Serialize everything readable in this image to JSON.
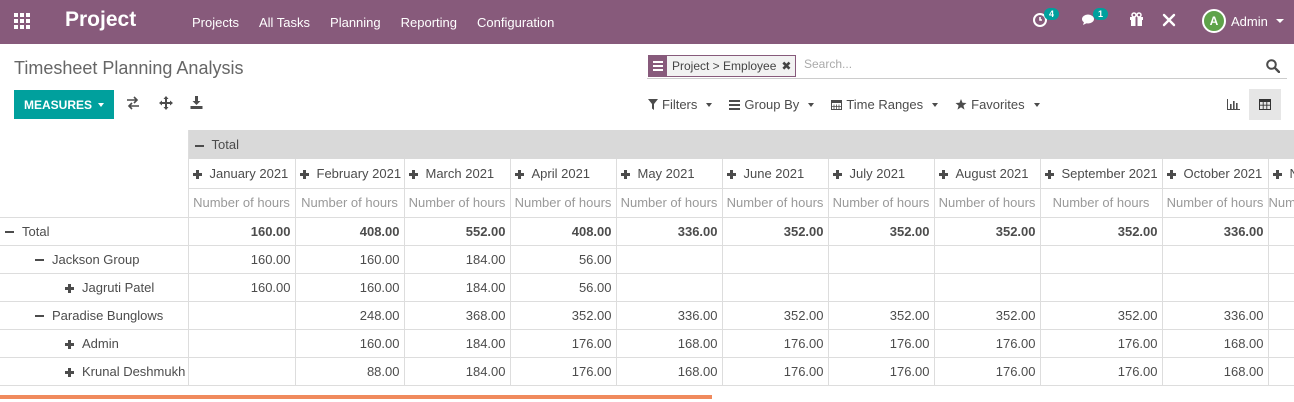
{
  "navbar": {
    "app_name": "Project",
    "menu": [
      "Projects",
      "All Tasks",
      "Planning",
      "Reporting",
      "Configuration"
    ],
    "activity_badge": "4",
    "messages_badge": "1",
    "avatar_initial": "A",
    "user_name": "Admin",
    "color": "#875a7b"
  },
  "control": {
    "title": "Timesheet Planning Analysis",
    "facet_label": "Project > Employee",
    "search_placeholder": "Search...",
    "measures_label": "MEASURES",
    "filters_label": "Filters",
    "group_by_label": "Group By",
    "time_ranges_label": "Time Ranges",
    "favorites_label": "Favorites",
    "accent": "#00a09d"
  },
  "pivot": {
    "total_header": "Total",
    "measure_label": "Number of hours",
    "columns": [
      "January 2021",
      "February 2021",
      "March 2021",
      "April 2021",
      "May 2021",
      "June 2021",
      "July 2021",
      "August 2021",
      "September 2021",
      "October 2021",
      "N"
    ],
    "rows": [
      {
        "label": "Total",
        "level": 0,
        "expanded": true,
        "bold": true,
        "values": [
          "160.00",
          "408.00",
          "552.00",
          "408.00",
          "336.00",
          "352.00",
          "352.00",
          "352.00",
          "352.00",
          "336.00",
          ""
        ]
      },
      {
        "label": "Jackson Group",
        "level": 1,
        "expanded": true,
        "bold": false,
        "values": [
          "160.00",
          "160.00",
          "184.00",
          "56.00",
          "",
          "",
          "",
          "",
          "",
          "",
          ""
        ]
      },
      {
        "label": "Jagruti Patel",
        "level": 2,
        "expanded": false,
        "bold": false,
        "values": [
          "160.00",
          "160.00",
          "184.00",
          "56.00",
          "",
          "",
          "",
          "",
          "",
          "",
          ""
        ]
      },
      {
        "label": "Paradise Bunglows",
        "level": 1,
        "expanded": true,
        "bold": false,
        "values": [
          "",
          "248.00",
          "368.00",
          "352.00",
          "336.00",
          "352.00",
          "352.00",
          "352.00",
          "352.00",
          "336.00",
          ""
        ]
      },
      {
        "label": "Admin",
        "level": 2,
        "expanded": false,
        "bold": false,
        "values": [
          "",
          "160.00",
          "184.00",
          "176.00",
          "168.00",
          "176.00",
          "176.00",
          "176.00",
          "176.00",
          "168.00",
          ""
        ]
      },
      {
        "label": "Krunal Deshmukh",
        "level": 2,
        "expanded": false,
        "bold": false,
        "values": [
          "",
          "88.00",
          "184.00",
          "176.00",
          "168.00",
          "176.00",
          "176.00",
          "176.00",
          "176.00",
          "168.00",
          ""
        ]
      }
    ]
  },
  "loading_progress": 0.55
}
